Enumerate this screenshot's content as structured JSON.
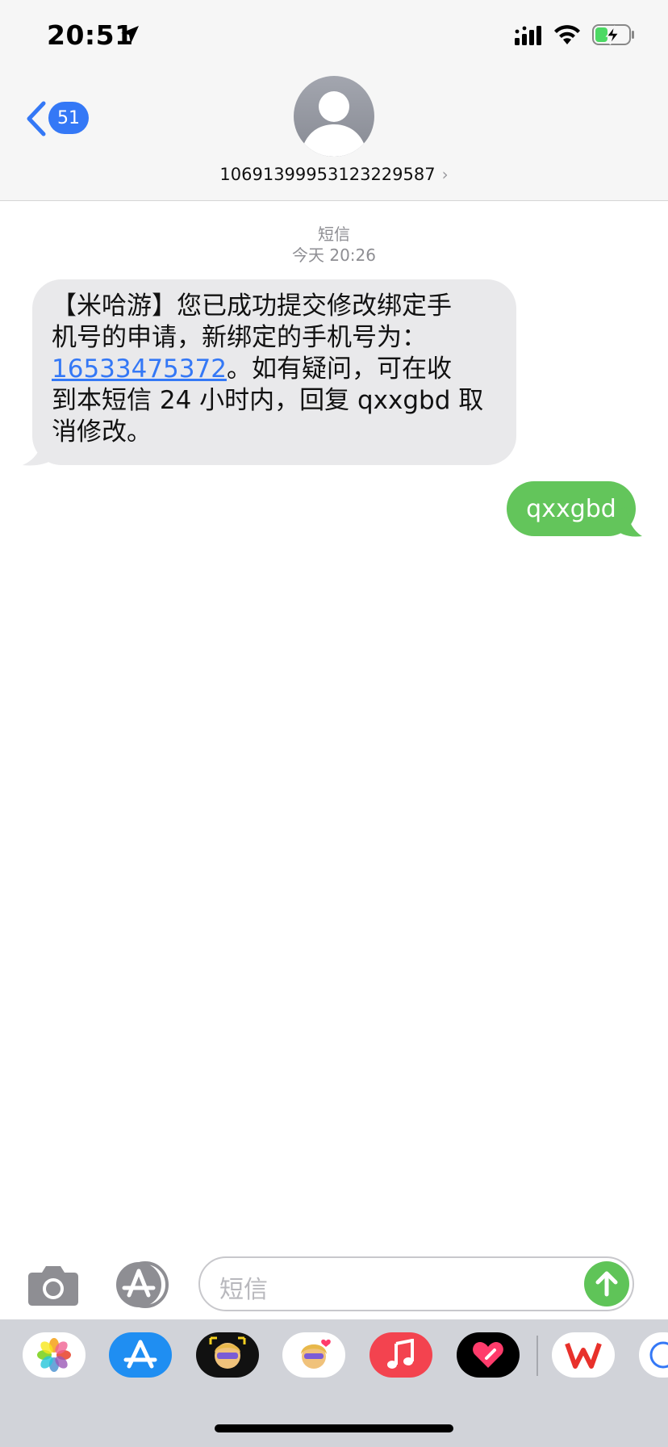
{
  "status_bar": {
    "time": "20:51",
    "icons": [
      "location-arrow-icon",
      "signal-icon",
      "wifi-icon",
      "battery-charging-icon"
    ]
  },
  "header": {
    "back_badge": "51",
    "contact_number": "10691399953123229587",
    "chevron": "›"
  },
  "conversation": {
    "service_label": "短信",
    "timestamp": "今天 20:26",
    "incoming": {
      "line1": "【米哈游】您已成功提交修改绑定手",
      "line2": "机号的申请，新绑定的手机号为：",
      "phone_link": "16533475372",
      "line3_rest": "。如有疑问，可在收",
      "line4": "到本短信 24 小时内，回复 qxxgbd 取",
      "line5": "消修改。"
    },
    "outgoing": {
      "text": "qxxgbd"
    }
  },
  "composer": {
    "placeholder": "短信"
  },
  "app_drawer": {
    "apps": [
      "photos-icon",
      "app-store-icon",
      "memoji-camera-icon",
      "memoji-stickers-icon",
      "music-icon",
      "digital-touch-icon",
      "wps-office-icon",
      "partial-app-icon"
    ]
  },
  "colors": {
    "accent_blue": "#3478f6",
    "sms_green": "#63c55b",
    "incoming_bubble": "#e9e9eb"
  }
}
